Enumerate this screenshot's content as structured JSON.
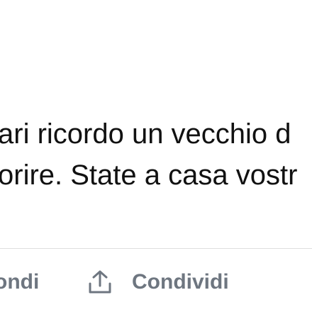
{
  "post": {
    "link_fragment": "i",
    "text_lines": [
      "ari ricordo un vecchio d",
      "orire. State a casa vostr"
    ]
  },
  "actions": {
    "reply_label": "ondi",
    "share_label": "Condividi"
  },
  "icons": {
    "share": "share-icon"
  },
  "colors": {
    "link": "#1d7bf0",
    "text": "#111111",
    "action": "#6e7680",
    "divider": "#dedede"
  }
}
